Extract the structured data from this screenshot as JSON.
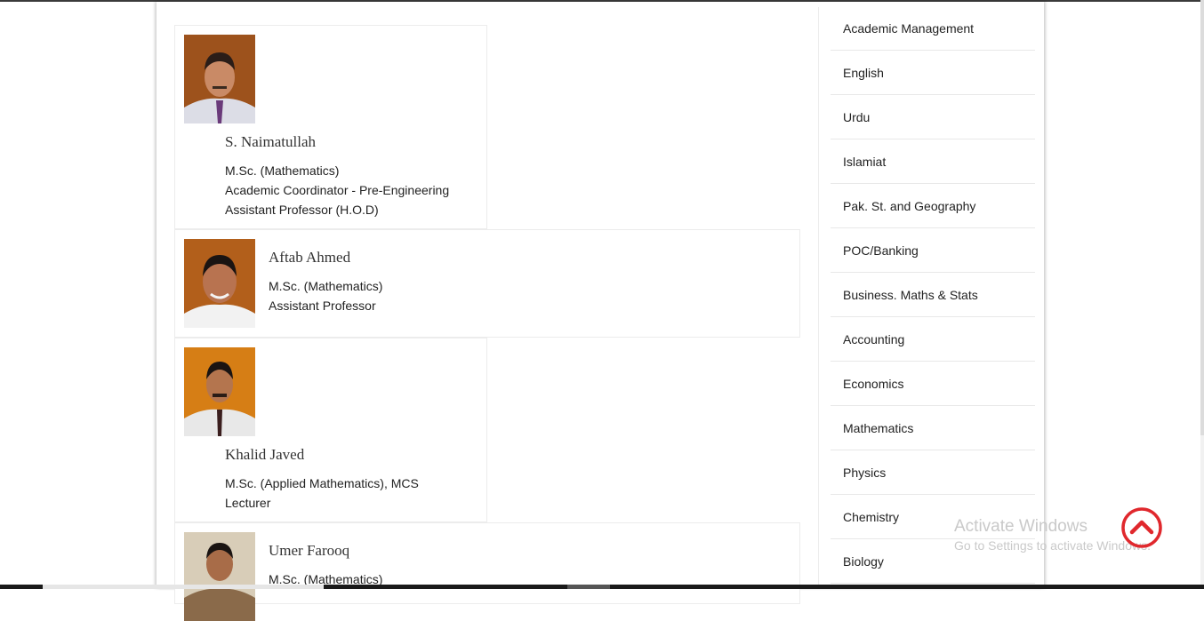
{
  "faculty": [
    {
      "name": "S. Naimatullah",
      "lines": [
        "M.Sc. (Mathematics)",
        "Academic Coordinator - Pre-Engineering",
        "Assistant Professor (H.O.D)"
      ]
    },
    {
      "name": "Aftab Ahmed",
      "lines": [
        "M.Sc. (Mathematics)",
        "Assistant Professor"
      ]
    },
    {
      "name": "Khalid Javed",
      "lines": [
        "M.Sc. (Applied Mathematics), MCS",
        "Lecturer"
      ]
    },
    {
      "name": "Umer Farooq",
      "lines": [
        "M.Sc. (Mathematics)"
      ]
    }
  ],
  "sidebar": {
    "items": [
      "Academic Management",
      "English",
      "Urdu",
      "Islamiat",
      "Pak. St. and Geography",
      "POC/Banking",
      "Business. Maths & Stats",
      "Accounting",
      "Economics",
      "Mathematics",
      "Physics",
      "Chemistry",
      "Biology"
    ]
  },
  "watermark": {
    "title": "Activate Windows",
    "subtitle": "Go to Settings to activate Windows."
  },
  "colors": {
    "accent": "#e0282d",
    "border": "#ececec"
  },
  "icons": {
    "scroll_top": "chevron-up-circle-icon"
  }
}
